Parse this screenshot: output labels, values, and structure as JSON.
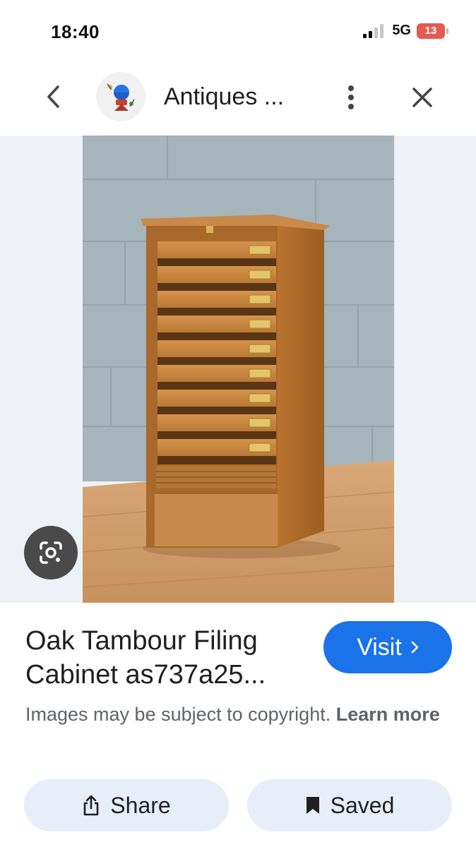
{
  "status_bar": {
    "time": "18:40",
    "network": "5G",
    "battery": "13"
  },
  "header": {
    "site_title": "Antiques ...",
    "back_icon": "chevron-left-icon",
    "more_icon": "more-vert-icon",
    "close_icon": "close-icon"
  },
  "image": {
    "subject": "oak tambour filing cabinet photo",
    "lens_icon": "google-lens-icon"
  },
  "result": {
    "title": "Oak Tambour Filing Cabinet as737a25...",
    "visit_label": "Visit",
    "copyright_text": "Images may be subject to copyright. ",
    "learn_more": "Learn more"
  },
  "actions": {
    "share_label": "Share",
    "saved_label": "Saved"
  },
  "colors": {
    "accent": "#1a73e8",
    "pill_bg": "#e8eef8",
    "battery_low": "#e25b4f"
  }
}
